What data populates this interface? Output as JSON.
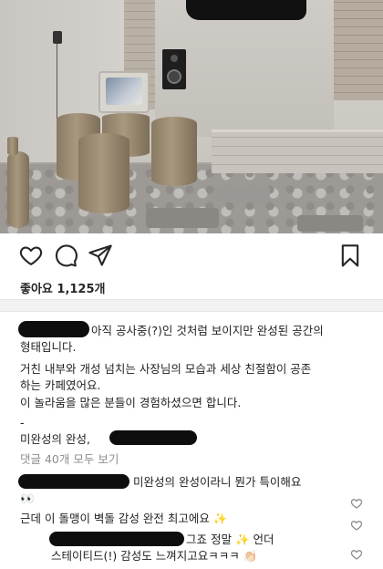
{
  "post": {
    "likes_label": "좋아요 1,125개"
  },
  "icons": {
    "like": "heart-outline-icon",
    "comment": "comment-bubble-icon",
    "share": "paper-plane-icon",
    "save": "bookmark-icon"
  },
  "caption": {
    "line1": "아직 공사중(?)인 것처럼 보이지만 완성된 공간의",
    "line2": "형태입니다.",
    "line3": "거친 내부와 개성 넘치는 사장님의 모습과 세상 친절함이 공존",
    "line4": "하는 카페였어요.",
    "line5": "이 놀라움을 많은 분들이 경험하셨으면 합니다.",
    "line6": "-",
    "line7": "미완성의 완성,"
  },
  "view_comments_label": "댓글 40개 모두 보기",
  "comments": [
    {
      "line1": "미완성의 완성이라니 뭔가 특이해요",
      "line2": "👀"
    },
    {
      "line1": "근데 이 돌맹이 벽돌 감성 완전 최고에요 ✨"
    },
    {
      "line1": "그죠 정말 ✨ 언더",
      "line2": "스테이티드(!) 감성도 느껴지고요ㅋㅋㅋ 👏🏻"
    }
  ]
}
